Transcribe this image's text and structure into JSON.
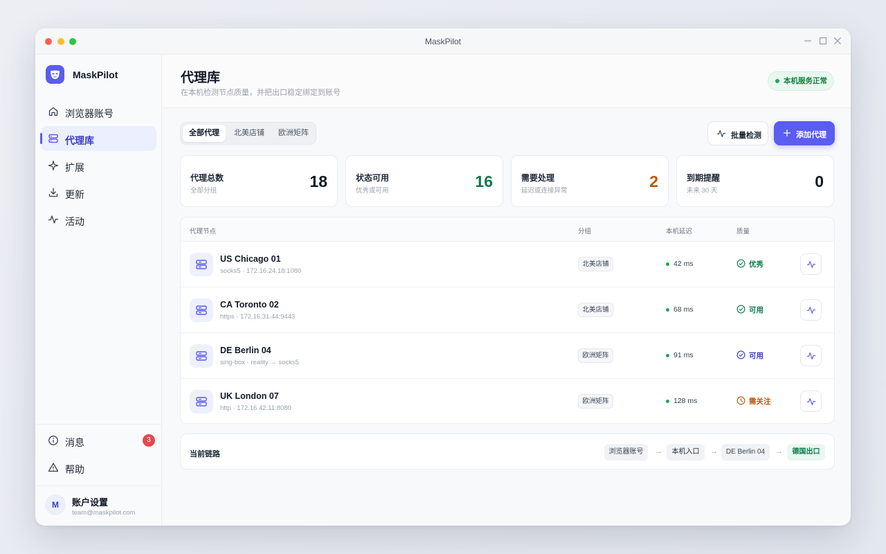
{
  "window": {
    "title": "MaskPilot"
  },
  "sidebar": {
    "brand": "MaskPilot",
    "items": [
      {
        "label": "浏览器账号",
        "icon": "home-icon"
      },
      {
        "label": "代理库",
        "icon": "server-icon",
        "active": true
      },
      {
        "label": "扩展",
        "icon": "sparkle-icon"
      },
      {
        "label": "更新",
        "icon": "download-icon"
      },
      {
        "label": "活动",
        "icon": "activity-icon"
      }
    ],
    "bottom": [
      {
        "label": "消息",
        "icon": "info-icon",
        "badge": "3"
      },
      {
        "label": "帮助",
        "icon": "warning-icon"
      }
    ],
    "account": {
      "avatar": "M",
      "name": "账户设置",
      "email": "team@maskpilot.com"
    }
  },
  "header": {
    "title": "代理库",
    "subtitle": "在本机检测节点质量，并把出口稳定绑定到账号",
    "status": "本机服务正常"
  },
  "tabs": [
    "全部代理",
    "北美店铺",
    "欧洲矩阵"
  ],
  "toolbar": {
    "check_label": "批量检测",
    "add_label": "添加代理"
  },
  "stats": [
    {
      "title": "代理总数",
      "sub": "全部分组",
      "value": "18",
      "color": "#111827"
    },
    {
      "title": "状态可用",
      "sub": "优秀或可用",
      "value": "16",
      "color": "#0f7a4d"
    },
    {
      "title": "需要处理",
      "sub": "延迟或连接异常",
      "value": "2",
      "color": "#c2560c"
    },
    {
      "title": "到期提醒",
      "sub": "未来 30 天",
      "value": "0",
      "color": "#111827"
    }
  ],
  "table": {
    "headers": [
      "代理节点",
      "分组",
      "本机延迟",
      "质量"
    ],
    "rows": [
      {
        "name": "US Chicago 01",
        "detail": "socks5 · 172.16.24.18:1080",
        "group": "北美店铺",
        "latency": "42 ms",
        "quality": "优秀",
        "quality_color": "#0f7a4d"
      },
      {
        "name": "CA Toronto 02",
        "detail": "https · 172.16.31.44:9443",
        "group": "北美店铺",
        "latency": "68 ms",
        "quality": "可用",
        "quality_color": "#0f7a4d"
      },
      {
        "name": "DE Berlin 04",
        "detail": "sing-box · reality → socks5",
        "group": "欧洲矩阵",
        "latency": "91 ms",
        "quality": "可用",
        "quality_color": "#3b3dc8"
      },
      {
        "name": "UK London 07",
        "detail": "http · 172.16.42.11:8080",
        "group": "欧洲矩阵",
        "latency": "128 ms",
        "quality": "需关注",
        "quality_color": "#c2560c"
      }
    ]
  },
  "route": {
    "label": "当前链路",
    "nodes": [
      "浏览器账号",
      "本机入口",
      "DE Berlin 04",
      "德国出口"
    ],
    "arrow": "→"
  }
}
